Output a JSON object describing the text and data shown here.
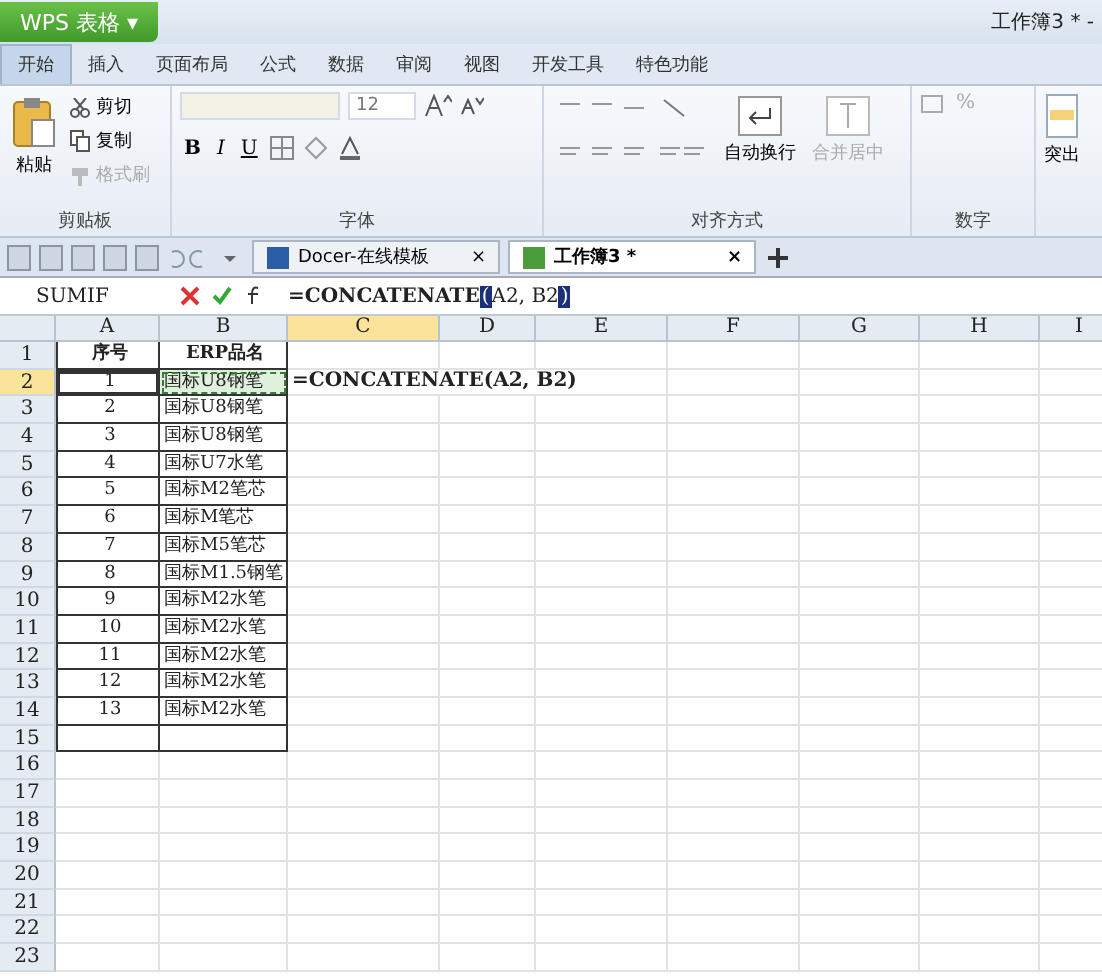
{
  "app_button": "WPS 表格",
  "app_caret": "▾",
  "window_title": "工作簿3 * -",
  "ribbon_tabs": [
    {
      "label": "开始",
      "selected": true
    },
    {
      "label": "插入",
      "selected": false
    },
    {
      "label": "页面布局",
      "selected": false
    },
    {
      "label": "公式",
      "selected": false
    },
    {
      "label": "数据",
      "selected": false
    },
    {
      "label": "审阅",
      "selected": false
    },
    {
      "label": "视图",
      "selected": false
    },
    {
      "label": "开发工具",
      "selected": false
    },
    {
      "label": "特色功能",
      "selected": false
    }
  ],
  "clipboard": {
    "paste": "粘贴",
    "cut": "剪切",
    "copy": "复制",
    "format_painter": "格式刷",
    "label": "剪贴板"
  },
  "font": {
    "size": "12",
    "bold": "B",
    "italic": "I",
    "underline": "U",
    "label": "字体"
  },
  "alignment": {
    "wrap": "自动换行",
    "merge": "合并居中",
    "label": "对齐方式"
  },
  "number": {
    "percent": "%",
    "label": "数字"
  },
  "highlight": "突出",
  "doc_tabs": [
    {
      "label": "Docer-在线模板",
      "selected": false,
      "close": "×"
    },
    {
      "label": "工作簿3 *",
      "selected": true,
      "close": "×"
    }
  ],
  "name_box": "SUMIF",
  "formula": {
    "name": "=CONCATENATE",
    "open": "(",
    "args": "A2, B2",
    "close": ")"
  },
  "columns": [
    {
      "label": "A",
      "selected": false
    },
    {
      "label": "B",
      "selected": false
    },
    {
      "label": "C",
      "selected": true
    },
    {
      "label": "D",
      "selected": false
    },
    {
      "label": "E",
      "selected": false
    },
    {
      "label": "F",
      "selected": false
    },
    {
      "label": "G",
      "selected": false
    },
    {
      "label": "H",
      "selected": false
    },
    {
      "label": "I",
      "selected": false
    }
  ],
  "rows": [
    {
      "num": "1",
      "selected": false,
      "a": "序号",
      "b": "ERP品名"
    },
    {
      "num": "2",
      "selected": true,
      "a": "1",
      "b": "国标U8钢笔",
      "c": "=CONCATENATE(A2, B2)"
    },
    {
      "num": "3",
      "selected": false,
      "a": "2",
      "b": "国标U8钢笔"
    },
    {
      "num": "4",
      "selected": false,
      "a": "3",
      "b": "国标U8钢笔"
    },
    {
      "num": "5",
      "selected": false,
      "a": "4",
      "b": "国标U7水笔"
    },
    {
      "num": "6",
      "selected": false,
      "a": "5",
      "b": "国标M2笔芯"
    },
    {
      "num": "7",
      "selected": false,
      "a": "6",
      "b": "国标M笔芯"
    },
    {
      "num": "8",
      "selected": false,
      "a": "7",
      "b": "国标M5笔芯"
    },
    {
      "num": "9",
      "selected": false,
      "a": "8",
      "b": "国标M1.5钢笔"
    },
    {
      "num": "10",
      "selected": false,
      "a": "9",
      "b": "国标M2水笔"
    },
    {
      "num": "11",
      "selected": false,
      "a": "10",
      "b": "国标M2水笔"
    },
    {
      "num": "12",
      "selected": false,
      "a": "11",
      "b": "国标M2水笔"
    },
    {
      "num": "13",
      "selected": false,
      "a": "12",
      "b": "国标M2水笔"
    },
    {
      "num": "14",
      "selected": false,
      "a": "13",
      "b": "国标M2水笔"
    },
    {
      "num": "15",
      "selected": false
    },
    {
      "num": "16",
      "selected": false
    },
    {
      "num": "17",
      "selected": false
    },
    {
      "num": "18",
      "selected": false
    },
    {
      "num": "19",
      "selected": false
    },
    {
      "num": "20",
      "selected": false
    },
    {
      "num": "21",
      "selected": false
    },
    {
      "num": "22",
      "selected": false
    },
    {
      "num": "23",
      "selected": false
    }
  ]
}
